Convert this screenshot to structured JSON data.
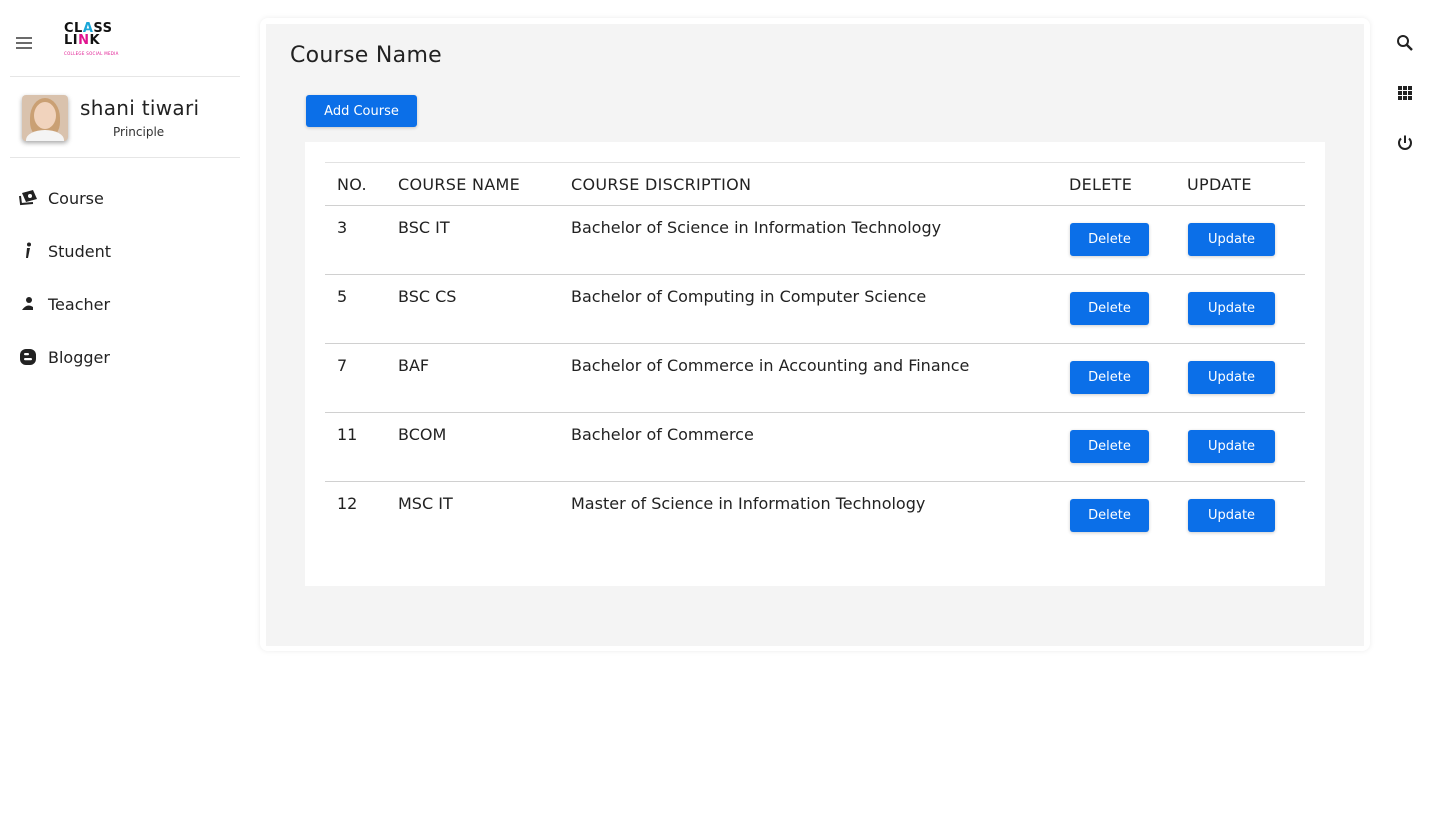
{
  "app": {
    "logo_line1_a": "CL",
    "logo_line1_b": "A",
    "logo_line1_c": "SS",
    "logo_line2_a": "LI",
    "logo_line2_b": "N",
    "logo_line2_c": "K",
    "logo_tagline": "COLLEGE SOCIAL MEDIA"
  },
  "profile": {
    "name": "shani tiwari",
    "role": "Principle"
  },
  "sidebar": {
    "items": [
      {
        "label": "Course",
        "icon": "course-icon"
      },
      {
        "label": "Student",
        "icon": "student-icon"
      },
      {
        "label": "Teacher",
        "icon": "teacher-icon"
      },
      {
        "label": "Blogger",
        "icon": "blogger-icon"
      }
    ]
  },
  "main": {
    "title": "Course Name",
    "add_button": "Add Course",
    "columns": [
      "NO.",
      "COURSE NAME",
      "COURSE DISCRIPTION",
      "DELETE",
      "UPDATE"
    ],
    "rows": [
      {
        "no": "3",
        "name": "BSC IT",
        "desc": "Bachelor of Science in Information Technology",
        "delete": "Delete",
        "update": "Update"
      },
      {
        "no": "5",
        "name": "BSC CS",
        "desc": "Bachelor of Computing in Computer Science",
        "delete": "Delete",
        "update": "Update"
      },
      {
        "no": "7",
        "name": "BAF",
        "desc": "Bachelor of Commerce in Accounting and Finance",
        "delete": "Delete",
        "update": "Update"
      },
      {
        "no": "11",
        "name": "BCOM",
        "desc": "Bachelor of Commerce",
        "delete": "Delete",
        "update": "Update"
      },
      {
        "no": "12",
        "name": "MSC IT",
        "desc": "Master of Science in Information Technology",
        "delete": "Delete",
        "update": "Update"
      }
    ]
  },
  "rail": {
    "icons": [
      "search-icon",
      "apps-grid-icon",
      "power-icon"
    ]
  },
  "colors": {
    "primary": "#0b6fe8",
    "panel": "#f4f4f4",
    "logo_cyan": "#1aa6d8",
    "logo_magenta": "#e0148f"
  }
}
